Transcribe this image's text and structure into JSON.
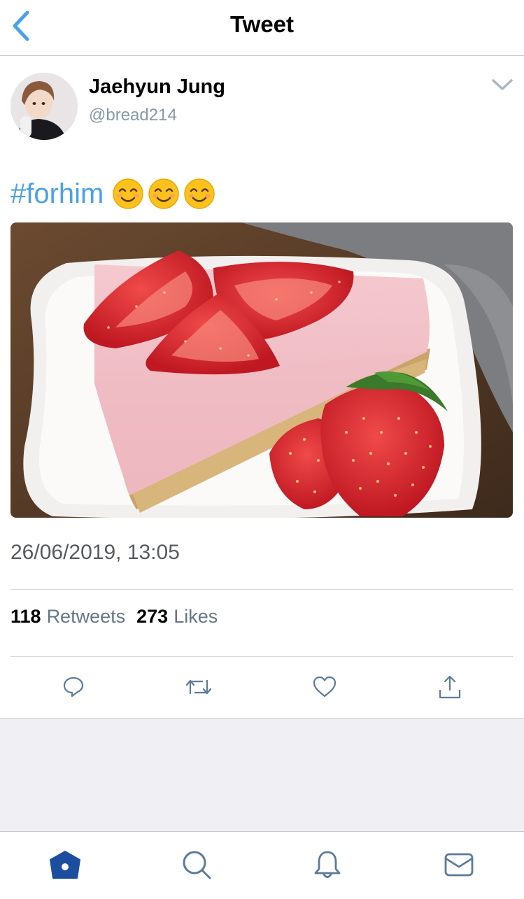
{
  "header": {
    "title": "Tweet",
    "back_icon": "chevron-left-icon"
  },
  "tweet": {
    "author": {
      "name": "Jaehyun Jung",
      "handle": "@bread214"
    },
    "hashtag": "#forhim",
    "emojis": [
      "😊",
      "😊",
      "😊"
    ],
    "timestamp": "26/06/2019, 13:05",
    "retweets": {
      "count": "118",
      "label": "Retweets"
    },
    "likes": {
      "count": "273",
      "label": "Likes"
    },
    "media_alt": "strawberry cheesecake photo"
  },
  "actions": {
    "reply_icon": "reply-icon",
    "retweet_icon": "retweet-icon",
    "like_icon": "heart-icon",
    "share_icon": "share-icon"
  },
  "tabbar": {
    "items": [
      "home-icon",
      "search-icon",
      "notifications-icon",
      "messages-icon"
    ],
    "active": "home-icon"
  },
  "colors": {
    "accent": "#4aa1eb",
    "active_tab": "#1c4ea0",
    "icon_gray": "#5a7b9a"
  }
}
